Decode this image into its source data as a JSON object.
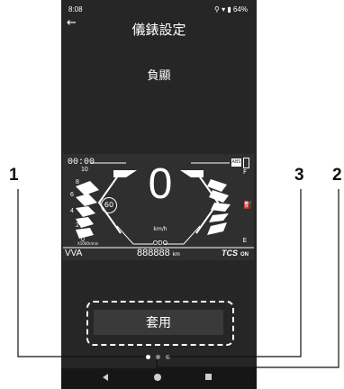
{
  "status_bar": {
    "time": "8:08",
    "battery": "64%"
  },
  "header": {
    "title": "儀錶設定",
    "back_icon": "arrow-left-icon"
  },
  "panel": {
    "subtitle": "負顯"
  },
  "dashboard": {
    "clock": "00:00",
    "speed": "0",
    "speed_unit": "km/h",
    "odo_label": "ODO",
    "odo_value": "888888",
    "odo_unit": "km",
    "speed_limit": "60",
    "rpm_ticks": [
      "10",
      "8",
      "6",
      "4",
      "2",
      "0"
    ],
    "rpm_unit": "X1000r/min",
    "ride_mode": "VVA",
    "tcs_label": "TCS",
    "tcs_state": "ON",
    "abs_badge": "ABS",
    "fuel_full": "F",
    "fuel_empty": "E"
  },
  "apply_button": {
    "label": "套用"
  },
  "page_indicator": {
    "count": 3,
    "active": 1
  },
  "callouts": {
    "left": "1",
    "middle": "3",
    "right": "2"
  },
  "colors": {
    "screen_bg": "#262626",
    "dash_bg": "#2f2f2f",
    "accent": "#ffffff"
  }
}
